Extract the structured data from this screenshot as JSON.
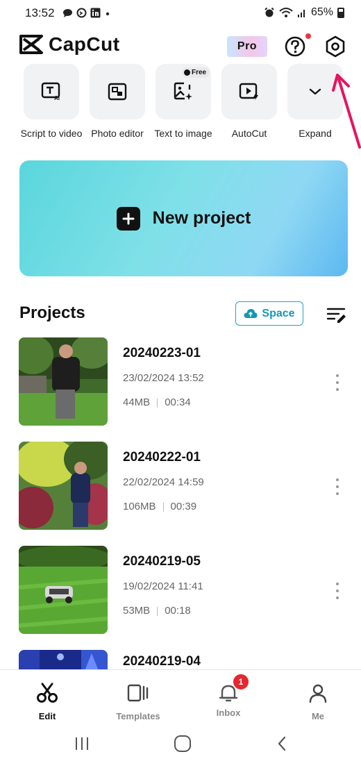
{
  "status_bar": {
    "time": "13:52",
    "battery": "65%"
  },
  "header": {
    "app_name": "CapCut",
    "pro_label": "Pro",
    "help_icon": "question-circle-icon",
    "settings_icon": "settings-hexagon-icon"
  },
  "tools": [
    {
      "label": "Script to video",
      "icon": "text-ai-icon"
    },
    {
      "label": "Photo editor",
      "icon": "photo-edit-icon"
    },
    {
      "label": "Text to image",
      "icon": "image-sparkle-icon",
      "tag": "Free"
    },
    {
      "label": "AutoCut",
      "icon": "autocut-icon"
    },
    {
      "label": "Expand",
      "icon": "chevron-down-icon"
    }
  ],
  "banner": {
    "label": "New project"
  },
  "projects": {
    "title": "Projects",
    "space_label": "Space",
    "items": [
      {
        "name": "20240223-01",
        "date": "23/02/2024 13:52",
        "size": "44MB",
        "duration": "00:34"
      },
      {
        "name": "20240222-01",
        "date": "22/02/2024 14:59",
        "size": "106MB",
        "duration": "00:39"
      },
      {
        "name": "20240219-05",
        "date": "19/02/2024 11:41",
        "size": "53MB",
        "duration": "00:18"
      },
      {
        "name": "20240219-04"
      }
    ]
  },
  "bottom_nav": {
    "items": [
      {
        "label": "Edit",
        "icon": "scissors-icon",
        "active": true
      },
      {
        "label": "Templates",
        "icon": "templates-icon"
      },
      {
        "label": "Inbox",
        "icon": "bell-icon",
        "badge": "1"
      },
      {
        "label": "Me",
        "icon": "person-icon"
      }
    ]
  },
  "colors": {
    "accent_teal": "#1497b4",
    "badge_red": "#e4282f",
    "annotation_arrow": "#e8135f"
  }
}
